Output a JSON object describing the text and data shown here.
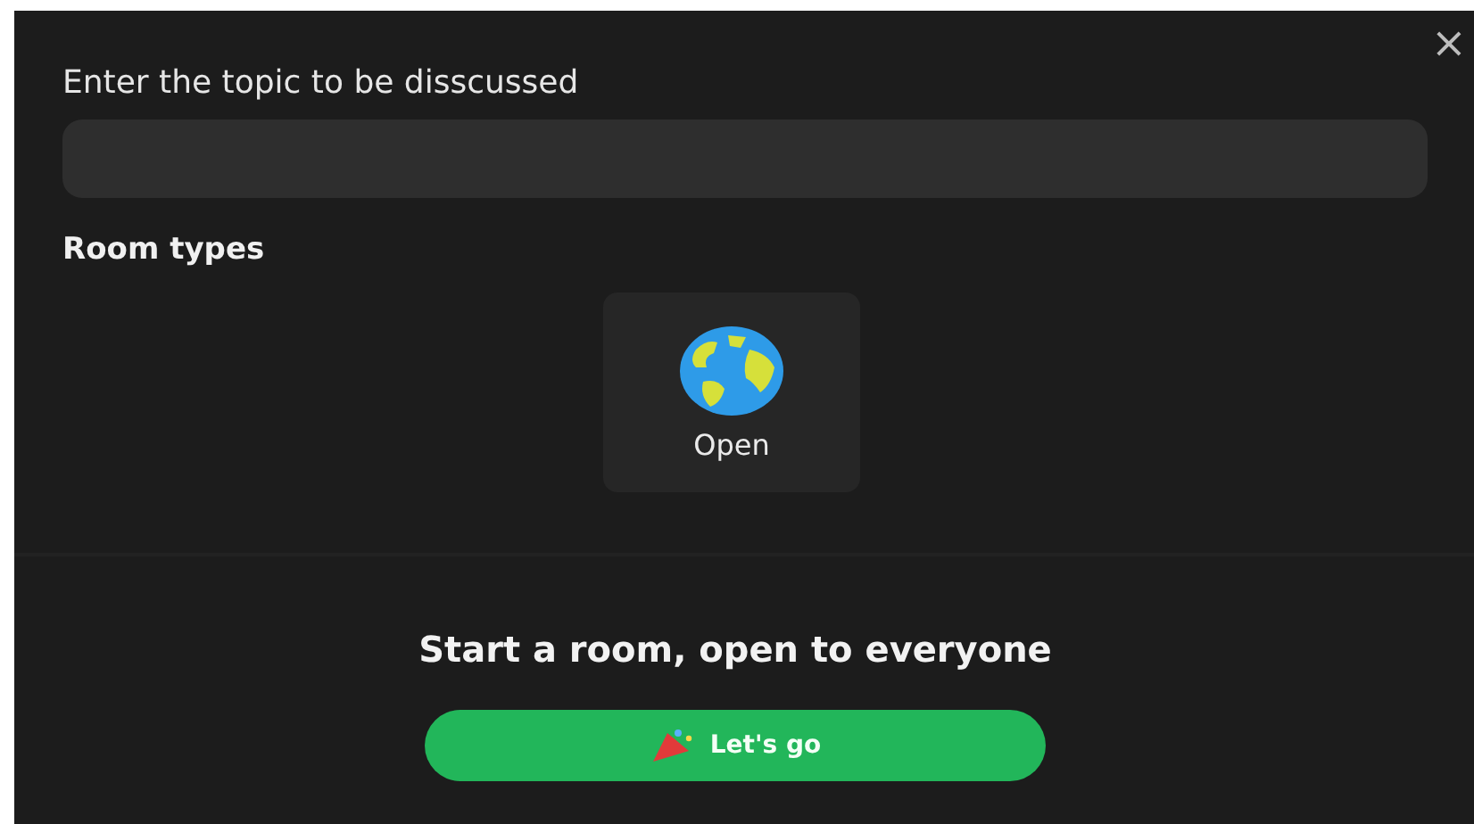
{
  "dialog": {
    "close": "×",
    "topic_label": "Enter the topic to be disscussed",
    "room_types_heading": "Room types",
    "room_types": [
      {
        "label": "Open",
        "kind": "globe"
      }
    ],
    "summary": "Start a room, open to everyone",
    "submit": "Let's go"
  }
}
